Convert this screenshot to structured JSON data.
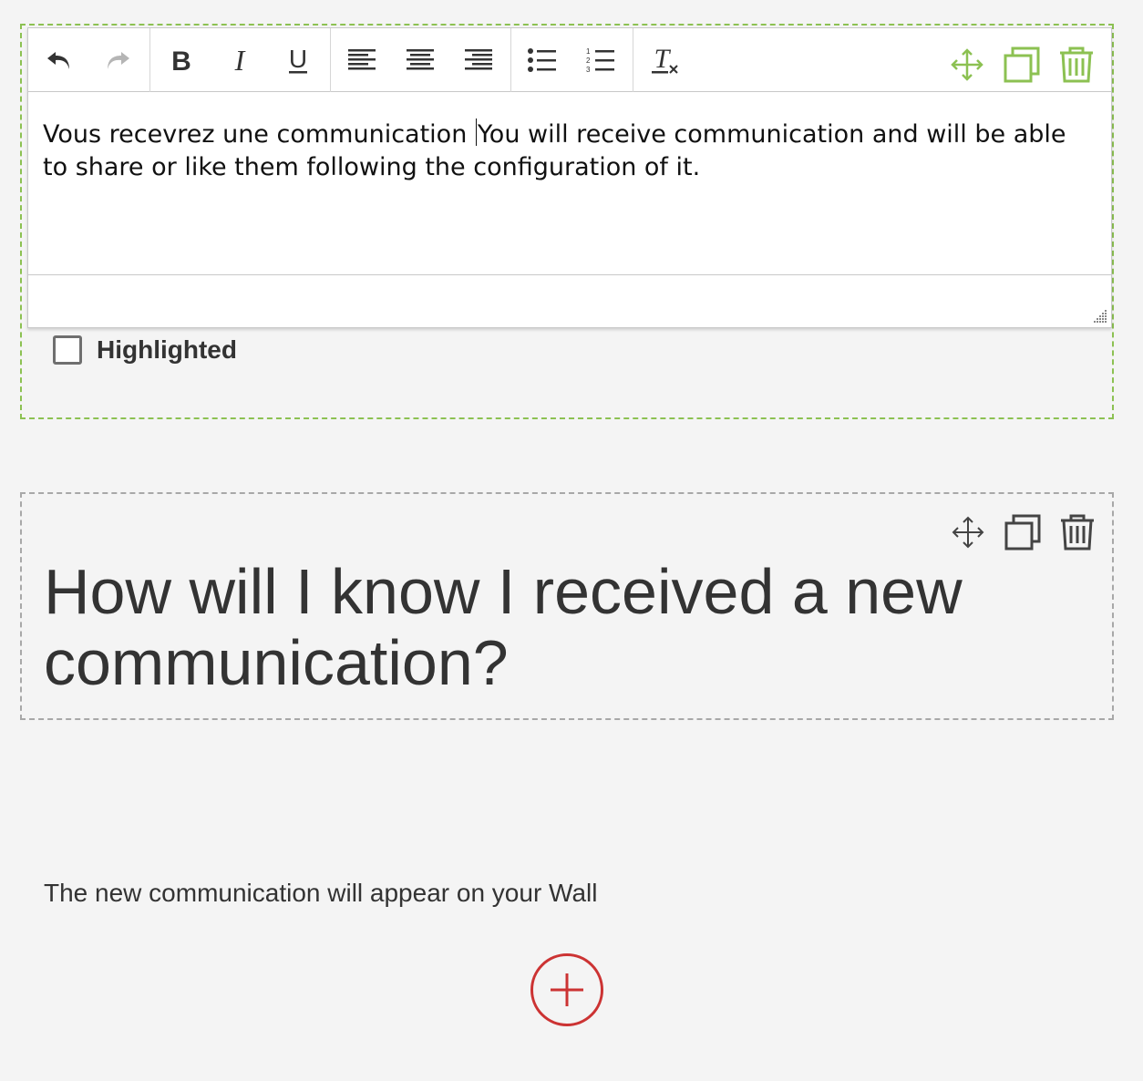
{
  "editor_block": {
    "content_prefix": "Vous recevrez une communication ",
    "content_rest": "You will receive communication and will be able to share or like them following the configuration of it.",
    "highlighted_label": "Highlighted",
    "highlighted_checked": false,
    "toolbar": [
      "undo",
      "redo",
      "bold",
      "italic",
      "underline",
      "align-left",
      "align-center",
      "align-right",
      "bulleted-list",
      "numbered-list",
      "clear-formatting"
    ],
    "action_color": "#8cc152"
  },
  "heading_block": {
    "title": "How will I know I received a new communication?"
  },
  "answer_block": {
    "text": "The new communication will appear on your Wall"
  },
  "colors": {
    "active_border": "#8cc152",
    "inactive_border": "#a8a8a8",
    "add_button": "#cc3333",
    "background": "#f4f4f4"
  }
}
